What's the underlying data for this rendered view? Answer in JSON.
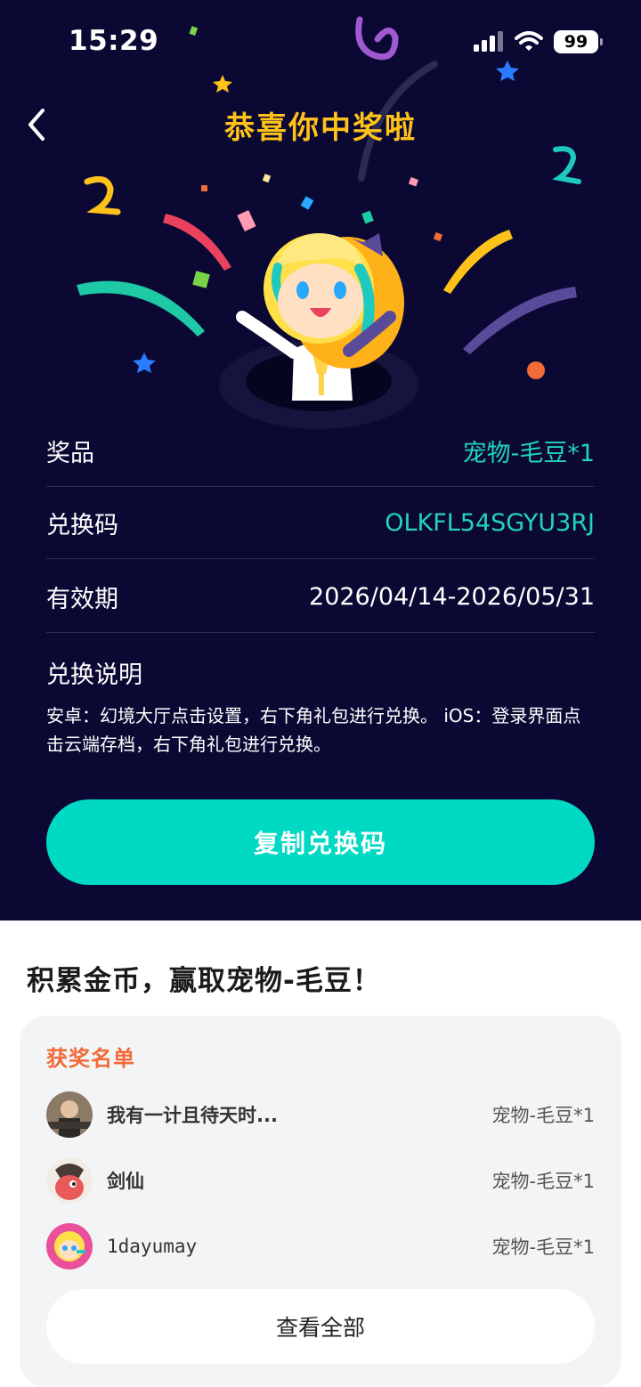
{
  "status_bar": {
    "time": "15:29",
    "battery": "99"
  },
  "header": {
    "title": "恭喜你中奖啦"
  },
  "prize_info": {
    "prize_label": "奖品",
    "prize_value": "宠物-毛豆*1",
    "code_label": "兑换码",
    "code_value": "OLKFL54SGYU3RJ",
    "validity_label": "有效期",
    "validity_value": "2026/04/14-2026/05/31",
    "instructions_title": "兑换说明",
    "instructions_text": "安卓：幻境大厅点击设置，右下角礼包进行兑换。 iOS：登录界面点击云端存档，右下角礼包进行兑换。"
  },
  "copy_button": {
    "label": "复制兑换码"
  },
  "promo": {
    "title": "积累金币，赢取宠物-毛豆！"
  },
  "winners": {
    "title": "获奖名单",
    "items": [
      {
        "name": "我有一计且待天时...",
        "prize": "宠物-毛豆*1"
      },
      {
        "name": "剑仙",
        "prize": "宠物-毛豆*1"
      },
      {
        "name": "1dayumay",
        "prize": "宠物-毛豆*1"
      }
    ],
    "view_all_label": "查看全部"
  },
  "colors": {
    "background": "#0b0933",
    "accent_teal": "#00d9c4",
    "title_gold": "#ffc21a",
    "winners_title": "#f26a36"
  },
  "icons": [
    "back-chevron-icon",
    "signal-icon",
    "wifi-icon",
    "battery-icon"
  ]
}
